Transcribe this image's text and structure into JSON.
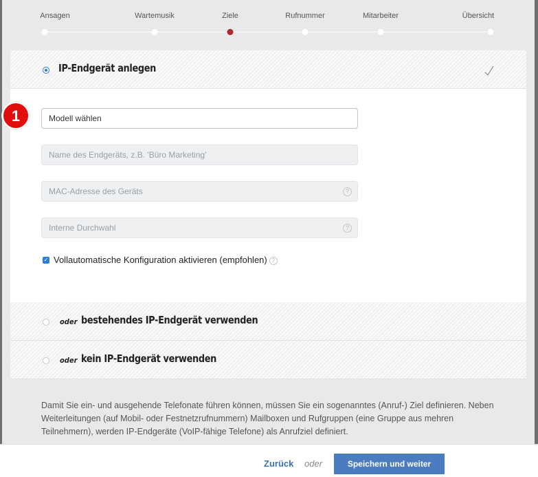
{
  "stepper": {
    "steps": [
      {
        "label": "Ansagen"
      },
      {
        "label": "Wartemusik"
      },
      {
        "label": "Ziele"
      },
      {
        "label": "Rufnummer"
      },
      {
        "label": "Mitarbeiter"
      },
      {
        "label": "Übersicht"
      }
    ],
    "active_step": "Ziele"
  },
  "option_new": {
    "title": "IP-Endgerät anlegen",
    "selected": true,
    "complete_icon": "check-icon"
  },
  "form": {
    "model_select": {
      "value": "Modell wählen"
    },
    "device_name": {
      "placeholder": "Name des Endgeräts, z.B. 'Büro Marketing'"
    },
    "mac_address": {
      "placeholder": "MAC-Adresse des Geräts"
    },
    "extension": {
      "placeholder": "Interne Durchwahl"
    },
    "auto_config": {
      "label": "Vollautomatische Konfiguration aktivieren (empfohlen)",
      "checked": true
    }
  },
  "annotation": {
    "number": "1"
  },
  "option_existing": {
    "prefix": "oder",
    "title": "bestehendes IP-Endgerät verwenden"
  },
  "option_none": {
    "prefix": "oder",
    "title": "kein IP-Endgerät verwenden"
  },
  "info_text": "Damit Sie ein- und ausgehende Telefonate führen können, müssen Sie ein sogenanntes (Anruf-) Ziel definieren. Neben Weiterleitungen (auf Mobil- oder Festnetzrufnummern) Mailboxen und Rufgruppen (eine Gruppe aus mehren Teilnehmern), werden IP-Endgeräte (VoIP-fähige Telefone) als Anrufziel definiert.",
  "footer": {
    "back_label": "Zurück",
    "or_label": "oder",
    "save_label": "Speichern und weiter"
  },
  "colors": {
    "accent": "#4a7cbf",
    "active_step": "#b3262b",
    "badge": "#e10e0e"
  }
}
